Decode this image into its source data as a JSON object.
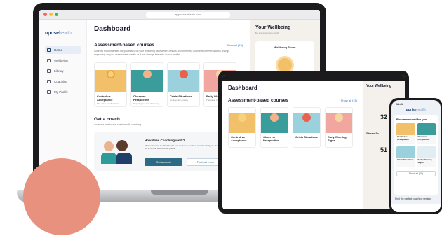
{
  "browser": {
    "url": "app.upriseheath.com"
  },
  "brand": {
    "logo_a": "uprise",
    "logo_b": "health"
  },
  "sidebar": {
    "items": [
      {
        "label": "Home",
        "active": true
      },
      {
        "label": "Wellbeing",
        "active": false
      },
      {
        "label": "Library",
        "active": false
      },
      {
        "label": "Coaching",
        "active": false
      },
      {
        "label": "My Profile",
        "active": false
      }
    ]
  },
  "dashboard": {
    "title": "Dashboard",
    "courses_title": "Assessment-based courses",
    "show_all": "Show all (15)",
    "courses_desc": "Courses recommended for you based on your wellbeing assessment results and interests. Course recommendations change depending on your assessment results or if you change interests in your profile.",
    "courses": [
      {
        "title": "Control vs Acceptance",
        "subtitle": "The value for situations",
        "meta": "3 min · 7 lessons"
      },
      {
        "title": "Observer Perspective",
        "subtitle": "Stepping out and observing",
        "meta": "5 min · 6 lessons"
      },
      {
        "title": "Crisis Situations",
        "subtitle": "Coping with anxiety",
        "meta": "3 min · 4 lessons"
      },
      {
        "title": "Early Warning Signs",
        "subtitle": "The value of signs",
        "meta": "4 min · 5 lessons"
      }
    ],
    "coach_title": "Get a coach",
    "coach_sub": "Access a one-to-one session with coaching",
    "coach_question": "How does Coaching work?",
    "coach_text": "All Coaches are Certified health and wellbeing coaches. Coaches help you identify areas to work on, in 30 min sessions via phone.",
    "coach_btn_primary": "Get a coach",
    "coach_btn_secondary": "Find out more"
  },
  "wellbeing": {
    "title": "Your Wellbeing",
    "subtitle": "My score over one month",
    "score_label": "Wellbeing Score",
    "score_value": "32",
    "stress_label": "Stress Sc",
    "stress_value": "51"
  },
  "phone": {
    "time": "12:41",
    "recommended": "Recommended for you",
    "show_all": "Show all (15)",
    "find": "Find the perfect coaching session"
  },
  "colors": {
    "accent": "#2d6a83",
    "brand": "#1f3f6b",
    "blob": "#e8917f"
  }
}
